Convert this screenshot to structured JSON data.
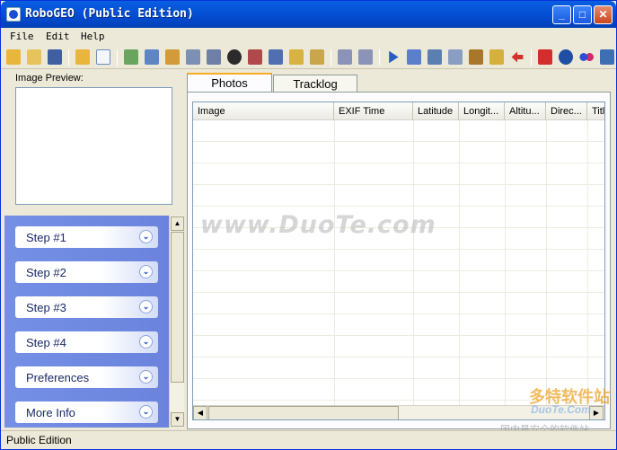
{
  "window": {
    "title": "RoboGEO (Public Edition)"
  },
  "menu": [
    {
      "label": "File"
    },
    {
      "label": "Edit"
    },
    {
      "label": "Help"
    }
  ],
  "left_pane": {
    "preview_label": "Image Preview:",
    "steps": [
      {
        "label": "Step #1"
      },
      {
        "label": "Step #2"
      },
      {
        "label": "Step #3"
      },
      {
        "label": "Step #4"
      },
      {
        "label": "Preferences"
      },
      {
        "label": "More Info"
      }
    ]
  },
  "tabs": [
    {
      "label": "Photos",
      "active": true
    },
    {
      "label": "Tracklog",
      "active": false
    }
  ],
  "grid": {
    "columns": [
      "Image",
      "EXIF Time",
      "Latitude",
      "Longit...",
      "Altitu...",
      "Direc...",
      "Titl"
    ]
  },
  "watermark": {
    "site": "www.DuoTe.com",
    "cn_brand": "多特软件站",
    "en_brand": "DuoTe.Com",
    "cn_tagline": "国内最安全的软件站"
  },
  "statusbar": {
    "text": "Public Edition"
  }
}
